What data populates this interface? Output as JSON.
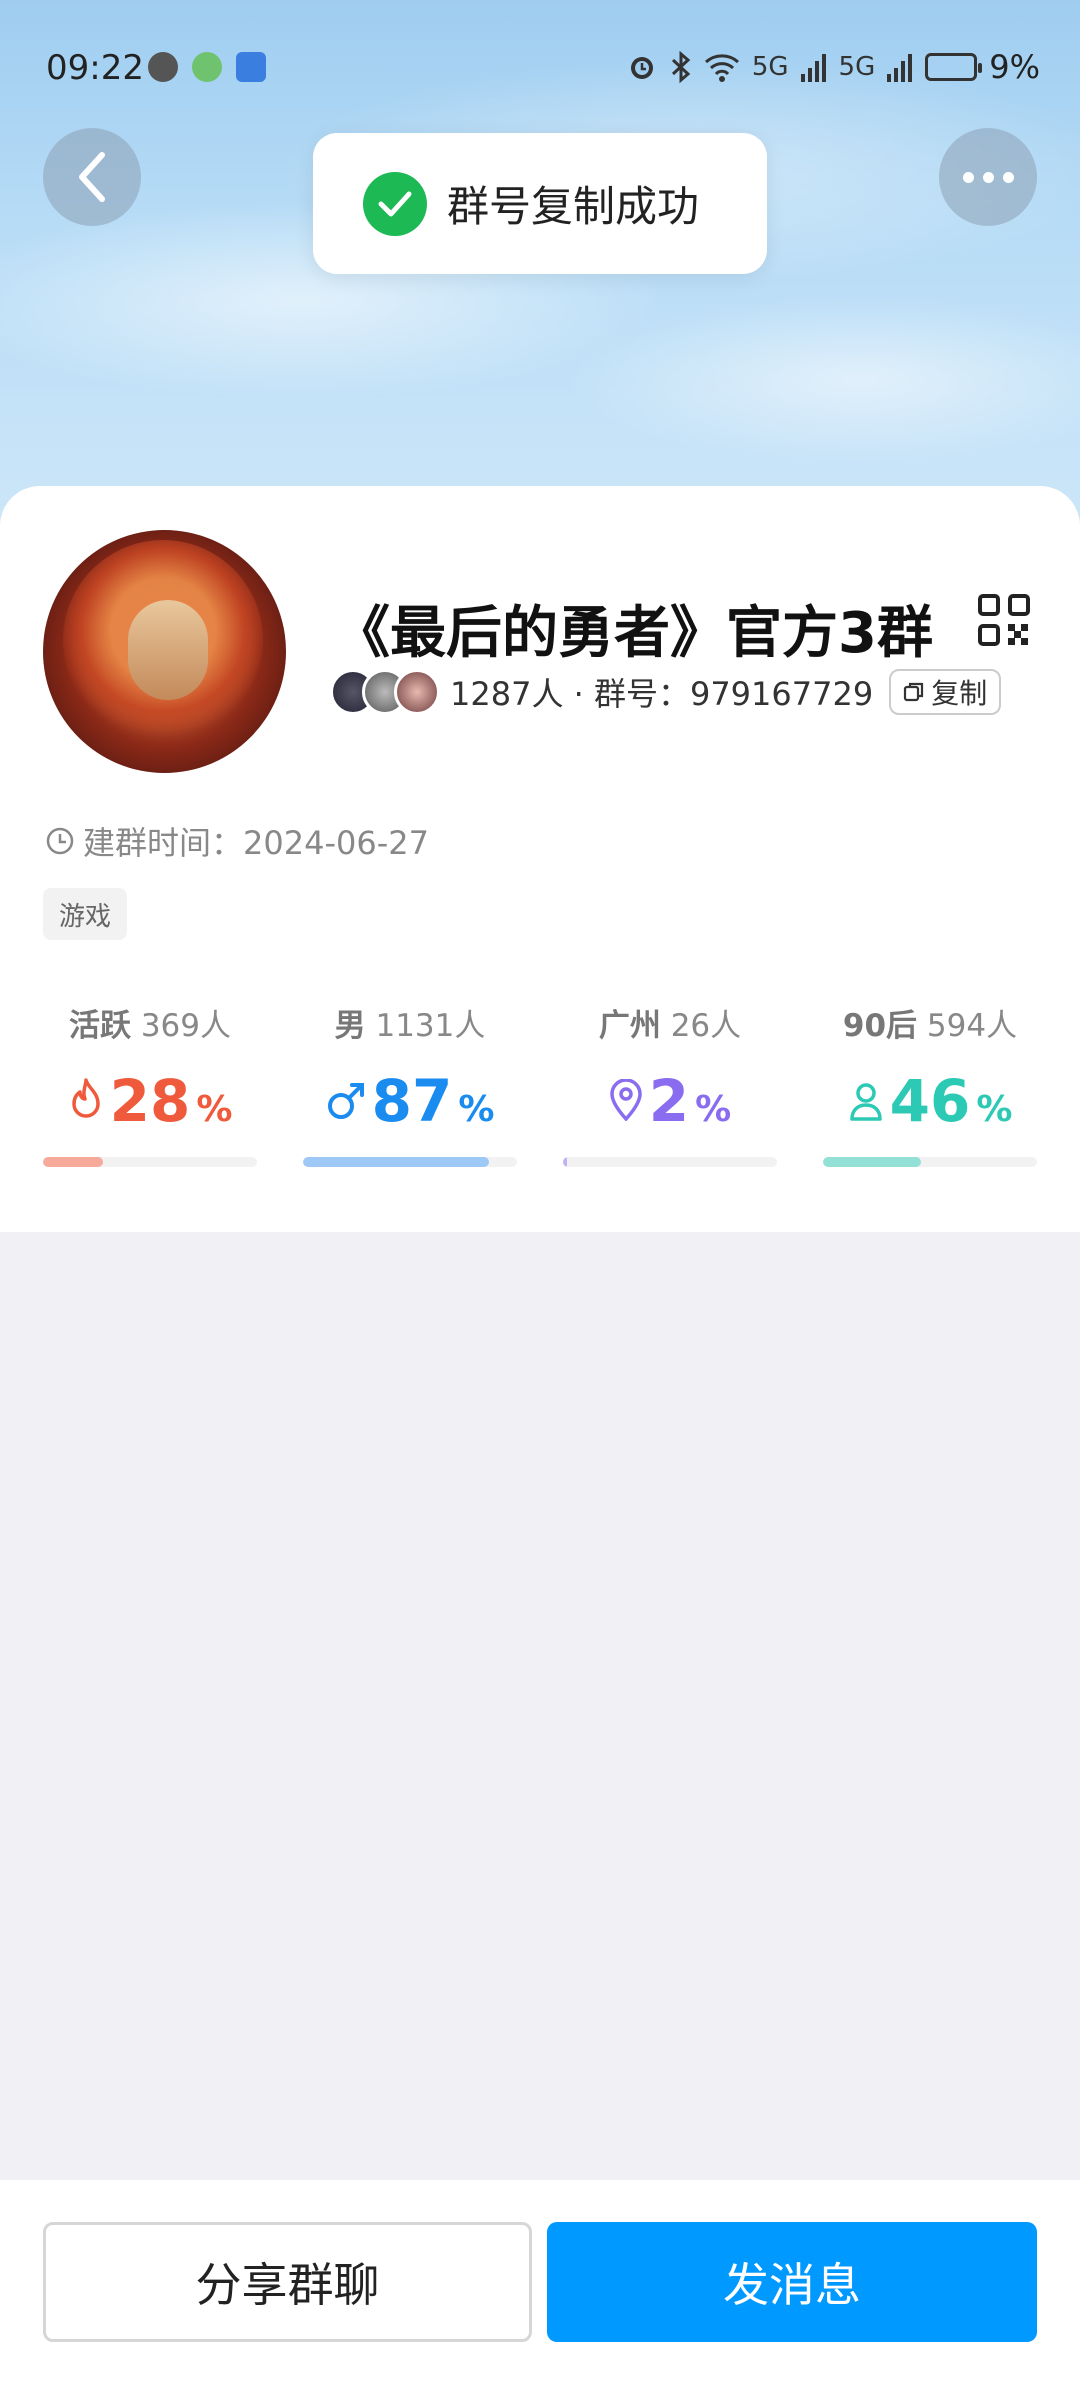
{
  "status_bar": {
    "time": "09:22",
    "battery": "9%",
    "signal1": "5G",
    "signal2": "5G",
    "left_icons": [
      "message-icon",
      "globe-icon",
      "weather-icon"
    ],
    "right_icons": [
      "alarm-icon",
      "bluetooth-icon",
      "wifi-icon",
      "signal-icon",
      "signal-icon",
      "battery-icon"
    ]
  },
  "toast": {
    "text": "群号复制成功",
    "icon": "check-icon",
    "color": "#1db954"
  },
  "group": {
    "name": "《最后的勇者》官方3群",
    "members_info": "1287人 · 群号：979167729",
    "copy_label": "复制",
    "created_label": "建群时间：2024-06-27",
    "tag": "游戏"
  },
  "stats": [
    {
      "label_bold": "活跃",
      "label_rest": " 369人",
      "value": "28",
      "pct": "%",
      "fill": 0.28,
      "color": "#f05a3c",
      "bar_color": "#f7a99a",
      "icon": "fire-icon"
    },
    {
      "label_bold": "男",
      "label_rest": " 1131人",
      "value": "87",
      "pct": "%",
      "fill": 0.87,
      "color": "#1a8cf0",
      "bar_color": "#9ec8f5",
      "icon": "male-icon"
    },
    {
      "label_bold": "广州",
      "label_rest": " 26人",
      "value": "2",
      "pct": "%",
      "fill": 0.02,
      "color": "#8a6cf0",
      "bar_color": "#c2b1f7",
      "icon": "location-icon"
    },
    {
      "label_bold": "90后",
      "label_rest": " 594人",
      "value": "46",
      "pct": "%",
      "fill": 0.46,
      "color": "#2cc9b4",
      "bar_color": "#93e1d6",
      "icon": "person-icon"
    }
  ],
  "actions": {
    "share": "分享群聊",
    "send": "发消息"
  },
  "colors": {
    "primary": "#0099ff",
    "background": "#f0f0f5"
  }
}
